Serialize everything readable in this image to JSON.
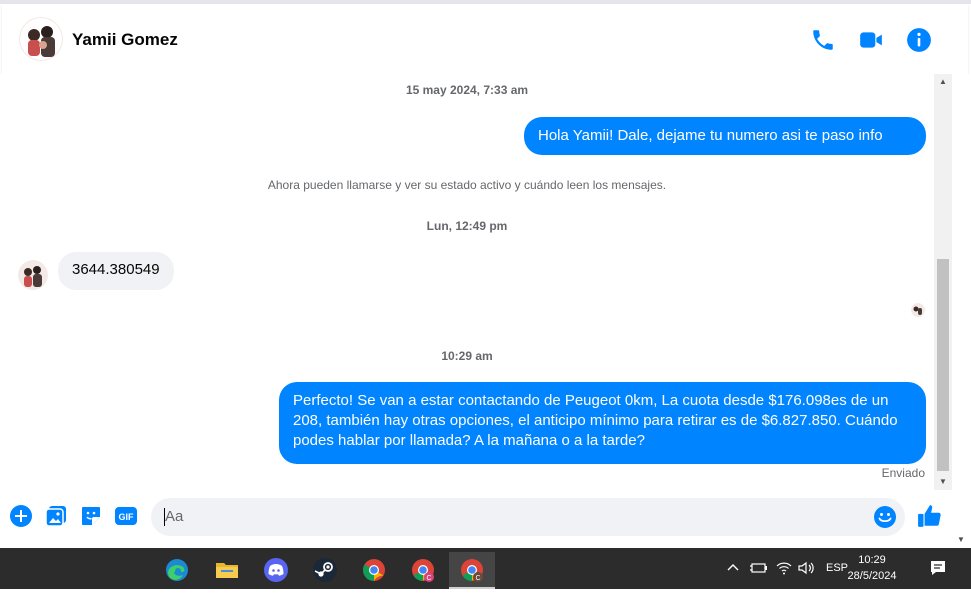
{
  "header": {
    "contact_name": "Yamii Gomez",
    "icons": [
      "phone-icon",
      "video-camera-icon",
      "info-icon"
    ]
  },
  "chat": {
    "timestamp_1": "15 may 2024, 7:33 am",
    "message_out_1": "Hola Yamii! Dale, dejame tu numero asi te paso info",
    "system_message": "Ahora pueden llamarse y ver su estado activo y cuándo leen los mensajes.",
    "timestamp_2": "Lun, 12:49 pm",
    "message_in_1": "3644.380549",
    "timestamp_3": "10:29 am",
    "message_out_2": "Perfecto!  Se van a estar contactando de Peugeot 0km, La cuota desde $176.098es de un 208, también hay otras opciones, el anticipo mínimo para retirar es de $6.827.850. Cuándo podes hablar por llamada? A la mañana o a la tarde?",
    "status": "Enviado"
  },
  "composer": {
    "placeholder": "Aa",
    "icons": [
      "add-icon",
      "photo-icon",
      "sticker-icon",
      "gif-icon",
      "emoji-icon",
      "thumbs-up-icon"
    ],
    "gif_label": "GIF"
  },
  "taskbar": {
    "apps": [
      "edge",
      "file-explorer",
      "discord",
      "steam",
      "chrome",
      "chrome-profile",
      "chrome-profile-active"
    ],
    "language": "ESP",
    "time": "10:29",
    "date": "28/5/2024"
  },
  "colors": {
    "accent": "#0084ff",
    "bubble_in": "#f0f2f5",
    "taskbar": "#2c2c2c"
  }
}
